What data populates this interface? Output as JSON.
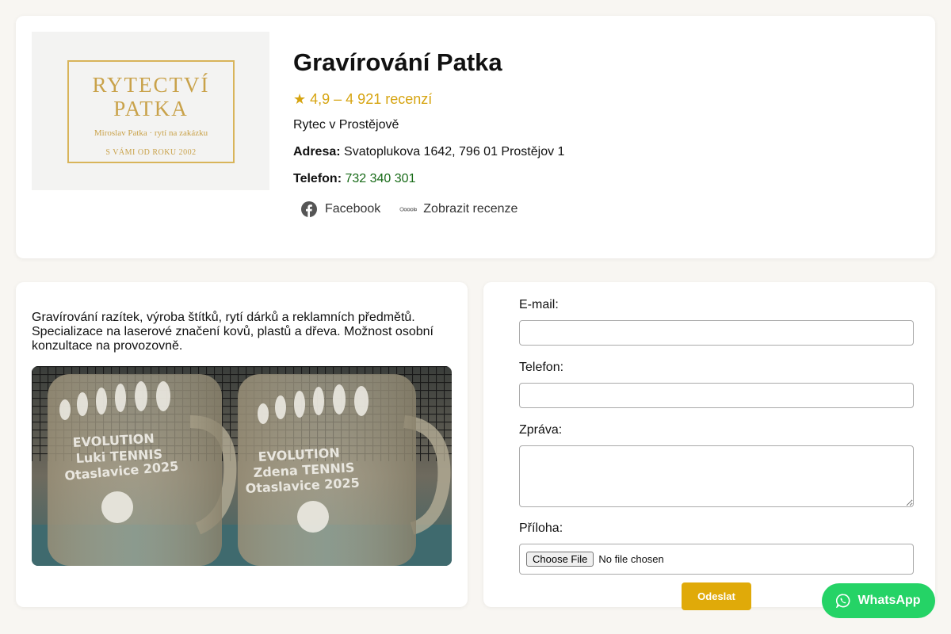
{
  "logo": {
    "line1": "RYTECTVÍ",
    "line2": "PATKA",
    "line3": "Miroslav Patka · rytí na zakázku",
    "line4": "S VÁMI OD ROKU 2002",
    "color": "#c9a24a"
  },
  "business": {
    "name": "Gravírování Patka",
    "rating": "★ 4,9 – 4 921 recenzí",
    "category": "Rytec v Prostějově",
    "address_label": "Adresa:",
    "address": "Svatoplukova 1642, 796 01 Prostějov 1",
    "phone_label": "Telefon:",
    "phone": "732 340 301"
  },
  "links": {
    "facebook": "Facebook",
    "reviews": "Zobrazit recenze"
  },
  "description": "Gravírování razítek, výroba štítků, rytí dárků a reklamních předmětů. Specializace na laserové značení kovů, plastů a dřeva. Možnost osobní konzultace na provozovně.",
  "photo": {
    "mug1": [
      "EVOLUTION",
      "Luki TENNIS",
      "Otaslavice 2025"
    ],
    "mug2": [
      "EVOLUTION",
      "Zdena TENNIS",
      "Otaslavice 2025"
    ]
  },
  "form": {
    "email_label": "E-mail:",
    "phone_label": "Telefon:",
    "message_label": "Zpráva:",
    "attachment_label": "Příloha:",
    "file_button": "Choose File",
    "file_status": "No file chosen",
    "submit": "Odeslat"
  },
  "whatsapp": "WhatsApp",
  "colors": {
    "accent": "#e0aa09",
    "rating": "#d6a410",
    "phone": "#176a17",
    "whatsapp": "#25d366"
  }
}
